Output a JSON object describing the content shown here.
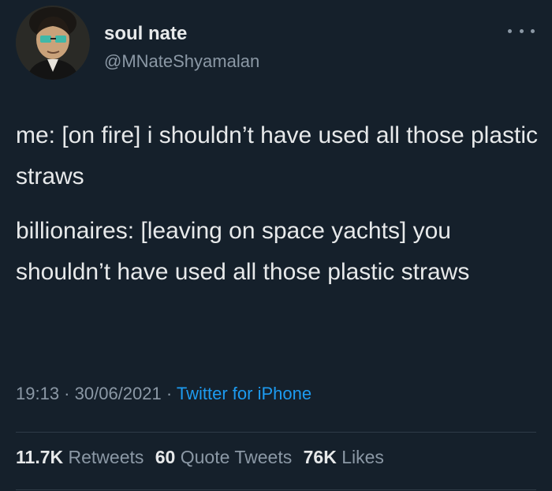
{
  "user": {
    "display_name": "soul nate",
    "handle": "@MNateShyamalan"
  },
  "tweet": {
    "paragraphs": [
      "me: [on fire] i shouldn’t have used all those plastic straws",
      "billionaires: [leaving on space yachts] you shouldn’t have used all those plastic straws"
    ],
    "time": "19:13",
    "separator": " · ",
    "date": "30/06/2021",
    "source": "Twitter for iPhone"
  },
  "stats": {
    "retweets": {
      "count": "11.7K",
      "label": "Retweets"
    },
    "quote_tweets": {
      "count": "60",
      "label": "Quote Tweets"
    },
    "likes": {
      "count": "76K",
      "label": "Likes"
    }
  },
  "icons": {
    "more": "more-horizontal-icon"
  },
  "colors": {
    "background": "#15202b",
    "text": "#e7e9ea",
    "secondary": "#8b98a5",
    "link": "#1d9bf0"
  }
}
